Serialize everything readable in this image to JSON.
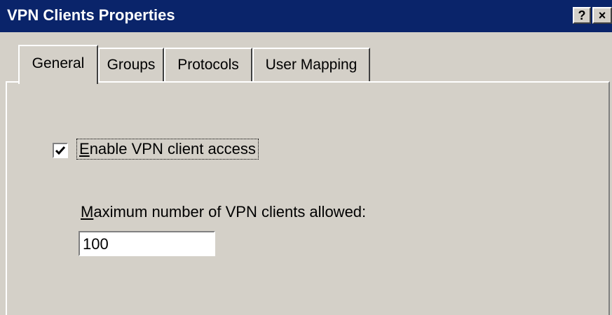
{
  "window": {
    "title": "VPN Clients Properties",
    "help_label": "?",
    "close_label": "×"
  },
  "tabs": [
    {
      "label": "General",
      "active": true
    },
    {
      "label": "Groups",
      "active": false
    },
    {
      "label": "Protocols",
      "active": false
    },
    {
      "label": "User Mapping",
      "active": false
    }
  ],
  "general": {
    "enable_checkbox": {
      "checked": true,
      "label_first": "E",
      "label_rest": "nable VPN client access"
    },
    "max_clients": {
      "label_first": "M",
      "label_rest": "aximum number of VPN clients allowed:",
      "value": "100"
    }
  },
  "colors": {
    "titlebar": "#0a246a",
    "face": "#d4d0c8"
  }
}
